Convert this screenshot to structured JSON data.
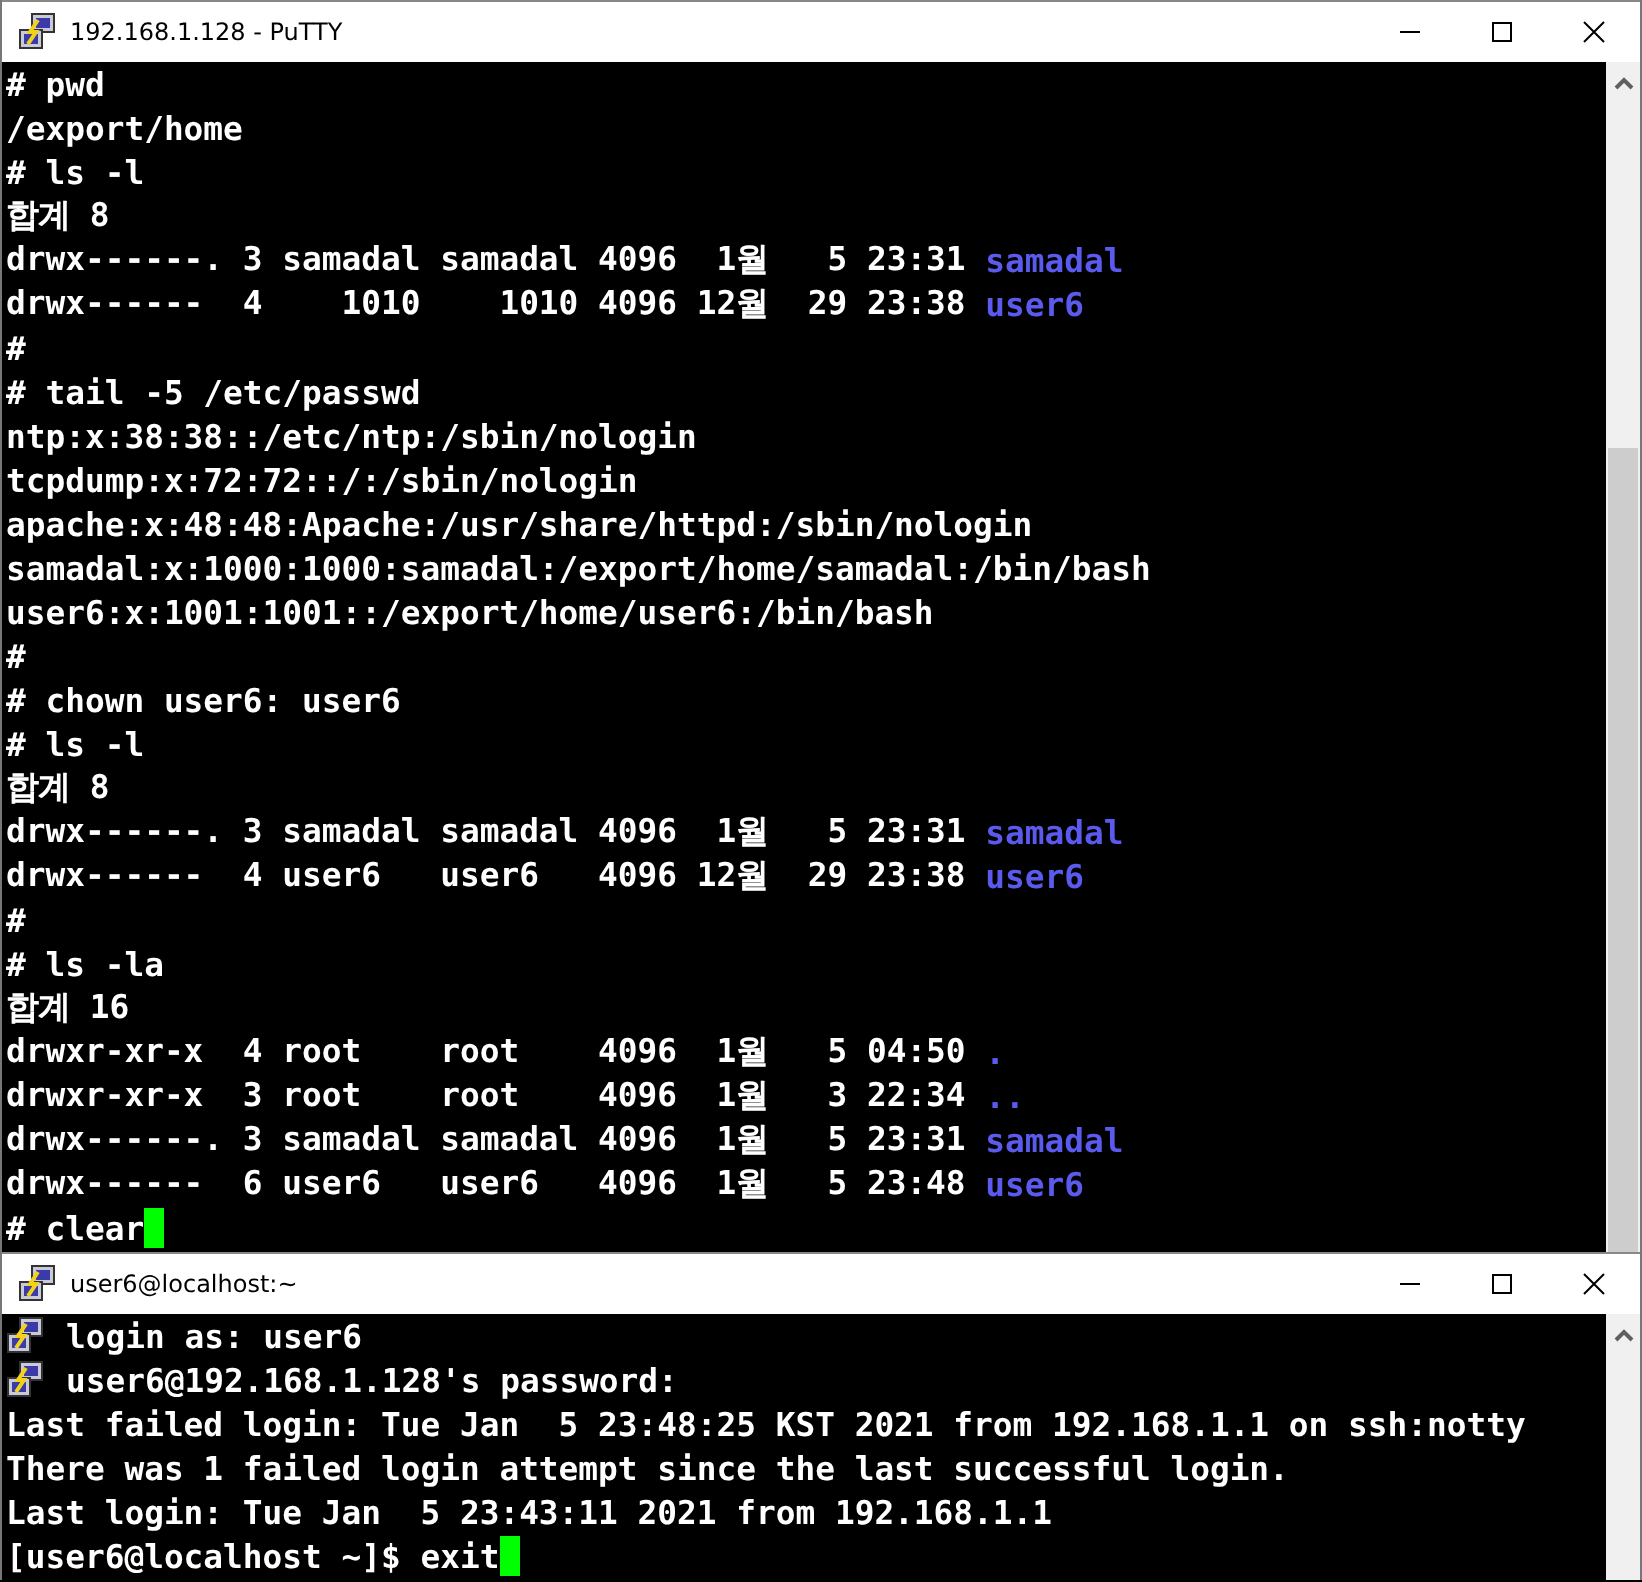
{
  "windows": [
    {
      "title": "192.168.1.128 - PuTTY",
      "scrollbar": {
        "level": 0.7
      },
      "lines": [
        {
          "segments": [
            {
              "kind": "plain",
              "text": "# pwd"
            }
          ]
        },
        {
          "segments": [
            {
              "kind": "plain",
              "text": "/export/home"
            }
          ]
        },
        {
          "segments": [
            {
              "kind": "plain",
              "text": "# ls -l"
            }
          ]
        },
        {
          "segments": [
            {
              "kind": "plain",
              "text": "합계 8"
            }
          ]
        },
        {
          "segments": [
            {
              "kind": "plain",
              "text": "drwx------. 3 samadal samadal 4096  1월   5 23:31 "
            },
            {
              "kind": "dir",
              "text": "samadal"
            }
          ]
        },
        {
          "segments": [
            {
              "kind": "plain",
              "text": "drwx------  4    1010    1010 4096 12월  29 23:38 "
            },
            {
              "kind": "dir",
              "text": "user6"
            }
          ]
        },
        {
          "segments": [
            {
              "kind": "plain",
              "text": "#"
            }
          ]
        },
        {
          "segments": [
            {
              "kind": "plain",
              "text": "# tail -5 /etc/passwd"
            }
          ]
        },
        {
          "segments": [
            {
              "kind": "plain",
              "text": "ntp:x:38:38::/etc/ntp:/sbin/nologin"
            }
          ]
        },
        {
          "segments": [
            {
              "kind": "plain",
              "text": "tcpdump:x:72:72::/:/sbin/nologin"
            }
          ]
        },
        {
          "segments": [
            {
              "kind": "plain",
              "text": "apache:x:48:48:Apache:/usr/share/httpd:/sbin/nologin"
            }
          ]
        },
        {
          "segments": [
            {
              "kind": "plain",
              "text": "samadal:x:1000:1000:samadal:/export/home/samadal:/bin/bash"
            }
          ]
        },
        {
          "segments": [
            {
              "kind": "plain",
              "text": "user6:x:1001:1001::/export/home/user6:/bin/bash"
            }
          ]
        },
        {
          "segments": [
            {
              "kind": "plain",
              "text": "#"
            }
          ]
        },
        {
          "segments": [
            {
              "kind": "plain",
              "text": "# chown user6: user6"
            }
          ]
        },
        {
          "segments": [
            {
              "kind": "plain",
              "text": "# ls -l"
            }
          ]
        },
        {
          "segments": [
            {
              "kind": "plain",
              "text": "합계 8"
            }
          ]
        },
        {
          "segments": [
            {
              "kind": "plain",
              "text": "drwx------. 3 samadal samadal 4096  1월   5 23:31 "
            },
            {
              "kind": "dir",
              "text": "samadal"
            }
          ]
        },
        {
          "segments": [
            {
              "kind": "plain",
              "text": "drwx------  4 user6   user6   4096 12월  29 23:38 "
            },
            {
              "kind": "dir",
              "text": "user6"
            }
          ]
        },
        {
          "segments": [
            {
              "kind": "plain",
              "text": "#"
            }
          ]
        },
        {
          "segments": [
            {
              "kind": "plain",
              "text": "# ls -la"
            }
          ]
        },
        {
          "segments": [
            {
              "kind": "plain",
              "text": "합계 16"
            }
          ]
        },
        {
          "segments": [
            {
              "kind": "plain",
              "text": "drwxr-xr-x  4 root    root    4096  1월   5 04:50 "
            },
            {
              "kind": "dir",
              "text": "."
            }
          ]
        },
        {
          "segments": [
            {
              "kind": "plain",
              "text": "drwxr-xr-x  3 root    root    4096  1월   3 22:34 "
            },
            {
              "kind": "dir",
              "text": ".."
            }
          ]
        },
        {
          "segments": [
            {
              "kind": "plain",
              "text": "drwx------. 3 samadal samadal 4096  1월   5 23:31 "
            },
            {
              "kind": "dir",
              "text": "samadal"
            }
          ]
        },
        {
          "segments": [
            {
              "kind": "plain",
              "text": "drwx------  6 user6   user6   4096  1월   5 23:48 "
            },
            {
              "kind": "dir",
              "text": "user6"
            }
          ]
        },
        {
          "segments": [
            {
              "kind": "plain",
              "text": "# clear"
            }
          ],
          "cursor": true
        }
      ]
    },
    {
      "title": "user6@localhost:~",
      "lines": [
        {
          "segments": [
            {
              "kind": "system",
              "text": "login as: user6"
            }
          ]
        },
        {
          "segments": [
            {
              "kind": "system",
              "text": "user6@192.168.1.128's password:"
            }
          ]
        },
        {
          "segments": [
            {
              "kind": "plain",
              "text": "Last failed login: Tue Jan  5 23:48:25 KST 2021 from 192.168.1.1 on ssh:notty"
            }
          ]
        },
        {
          "segments": [
            {
              "kind": "plain",
              "text": "There was 1 failed login attempt since the last successful login."
            }
          ]
        },
        {
          "segments": [
            {
              "kind": "plain",
              "text": "Last login: Tue Jan  5 23:43:11 2021 from 192.168.1.1"
            }
          ]
        },
        {
          "segments": [
            {
              "kind": "plain",
              "text": "[user6@localhost ~]$ exit"
            }
          ],
          "cursor": true
        }
      ]
    }
  ]
}
